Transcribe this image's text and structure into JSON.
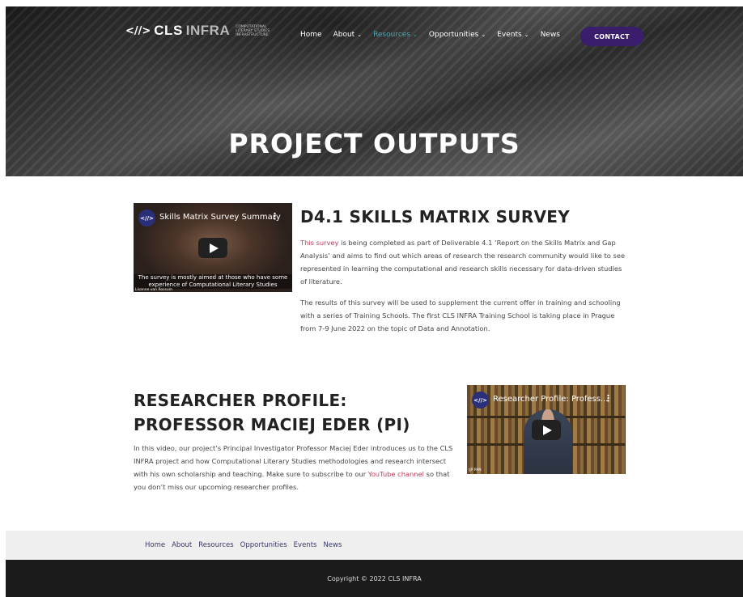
{
  "header": {
    "logo_mark": "<//>",
    "logo_cls": "CLS",
    "logo_infra": "INFRA",
    "logo_subtitle": "COMPUTATIONAL LITERARY STUDIES INFRASTRUCTURE",
    "nav": [
      {
        "label": "Home",
        "has_caret": false
      },
      {
        "label": "About",
        "has_caret": true
      },
      {
        "label": "Resources",
        "has_caret": true,
        "active": true
      },
      {
        "label": "Opportunities",
        "has_caret": true
      },
      {
        "label": "Events",
        "has_caret": true
      },
      {
        "label": "News",
        "has_caret": false
      }
    ],
    "caret": "⌄",
    "contact_label": "CONTACT",
    "hero_title": "PROJECT OUTPUTS",
    "colors": {
      "contact_bg": "#3a1d6d",
      "active_nav": "#4aa7b6"
    }
  },
  "section1": {
    "video": {
      "title": "Skills Matrix Survey Summary",
      "avatar": "<//>",
      "more": "⋮",
      "caption_line1": "The survey is mostly aimed at those who have some",
      "caption_line2": "experience of Computational Literary Studies",
      "credit": "Lisanne van Rossum"
    },
    "title": "D4.1 SKILLS MATRIX SURVEY",
    "para1_link": "This survey",
    "para1_rest": " is being completed as part of Deliverable 4.1 ‘Report on the Skills Matrix and Gap Analysis’ and aims to find out which areas of research the research community would like to see represented in learning the computational and research skills necessary for data-driven studies of literature.",
    "para2": "The results of this survey will be used to supplement the current offer in training and schooling with a series of Training Schools. The first CLS INFRA Training School is taking place in Prague from 7-9 June 2022 on the topic of Data and Annotation."
  },
  "section2": {
    "title_line1": "RESEARCHER PROFILE:",
    "title_line2": "PROFESSOR MACIEJ EDER (PI)",
    "para_before_link": "In this video, our project’s Principal Investigator Professor Maciej Eder introduces us to the CLS INFRA project and how Computational Literary Studies methodologies and research intersect with his own scholarship and teaching. Make sure to subscribe to our ",
    "para_link": "YouTube channel",
    "para_after_link": " so that you don’t miss our upcoming researcher profiles.",
    "video": {
      "title": "Researcher Profile: Profess...",
      "avatar": "<//>",
      "more": "⋮",
      "credit": "IJP PAN"
    }
  },
  "footer": {
    "nav": [
      "Home",
      "About",
      "Resources",
      "Opportunities",
      "Events",
      "News"
    ],
    "copyright": "Copyright © 2022 CLS INFRA"
  }
}
